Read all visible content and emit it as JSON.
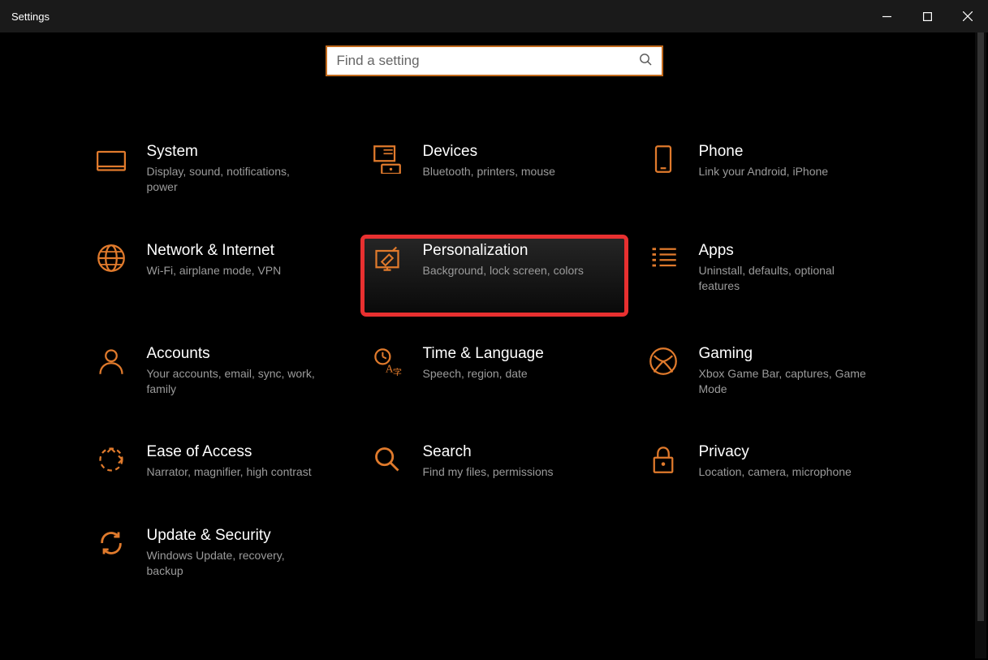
{
  "window": {
    "title": "Settings"
  },
  "search": {
    "placeholder": "Find a setting"
  },
  "tiles": [
    {
      "key": "system",
      "title": "System",
      "desc": "Display, sound, notifications, power"
    },
    {
      "key": "devices",
      "title": "Devices",
      "desc": "Bluetooth, printers, mouse"
    },
    {
      "key": "phone",
      "title": "Phone",
      "desc": "Link your Android, iPhone"
    },
    {
      "key": "network",
      "title": "Network & Internet",
      "desc": "Wi-Fi, airplane mode, VPN"
    },
    {
      "key": "personalization",
      "title": "Personalization",
      "desc": "Background, lock screen, colors",
      "highlight": true
    },
    {
      "key": "apps",
      "title": "Apps",
      "desc": "Uninstall, defaults, optional features"
    },
    {
      "key": "accounts",
      "title": "Accounts",
      "desc": "Your accounts, email, sync, work, family"
    },
    {
      "key": "time",
      "title": "Time & Language",
      "desc": "Speech, region, date"
    },
    {
      "key": "gaming",
      "title": "Gaming",
      "desc": "Xbox Game Bar, captures, Game Mode"
    },
    {
      "key": "ease",
      "title": "Ease of Access",
      "desc": "Narrator, magnifier, high contrast"
    },
    {
      "key": "search",
      "title": "Search",
      "desc": "Find my files, permissions"
    },
    {
      "key": "privacy",
      "title": "Privacy",
      "desc": "Location, camera, microphone"
    },
    {
      "key": "update",
      "title": "Update & Security",
      "desc": "Windows Update, recovery, backup"
    }
  ],
  "colors": {
    "accent": "#e07a2c",
    "highlight_border": "#e83030"
  }
}
